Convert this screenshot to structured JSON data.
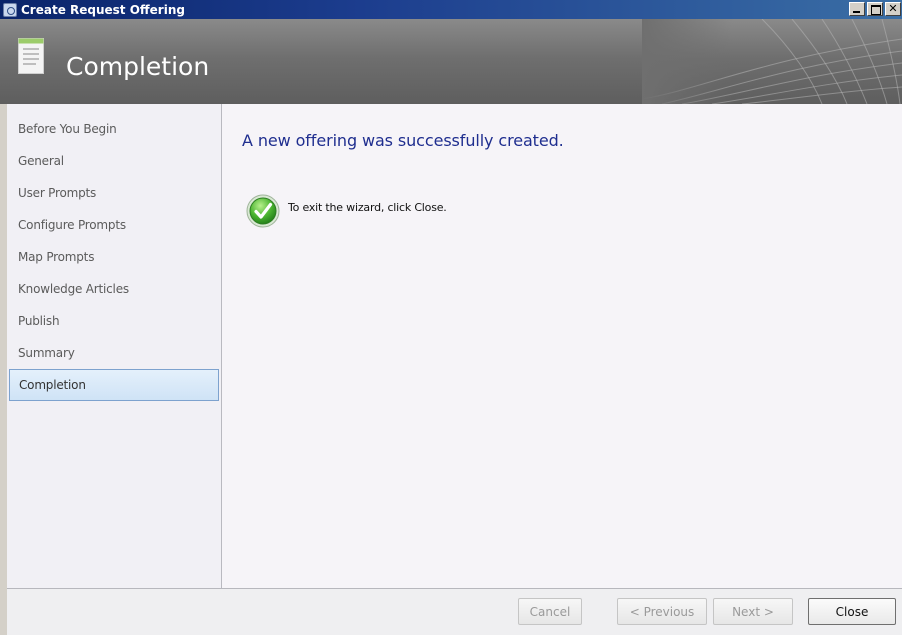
{
  "window": {
    "title": "Create Request Offering"
  },
  "header": {
    "title": "Completion"
  },
  "nav": {
    "items": [
      {
        "label": "Before You Begin"
      },
      {
        "label": "General"
      },
      {
        "label": "User Prompts"
      },
      {
        "label": "Configure Prompts"
      },
      {
        "label": "Map Prompts"
      },
      {
        "label": "Knowledge Articles"
      },
      {
        "label": "Publish"
      },
      {
        "label": "Summary"
      },
      {
        "label": "Completion"
      }
    ],
    "selected": "Completion"
  },
  "content": {
    "heading": "A new offering was successfully created.",
    "exit_text": "To exit the wizard, click Close.",
    "status_icon": "green-check-icon"
  },
  "footer": {
    "cancel_label": "Cancel",
    "previous_label": "< Previous",
    "next_label": "Next >",
    "close_label": "Close"
  },
  "colors": {
    "titlebar": "#0a246a",
    "heading_text": "#1f2e8f",
    "selected_nav_border": "#7da2ce",
    "check_green": "#3aa12a"
  }
}
